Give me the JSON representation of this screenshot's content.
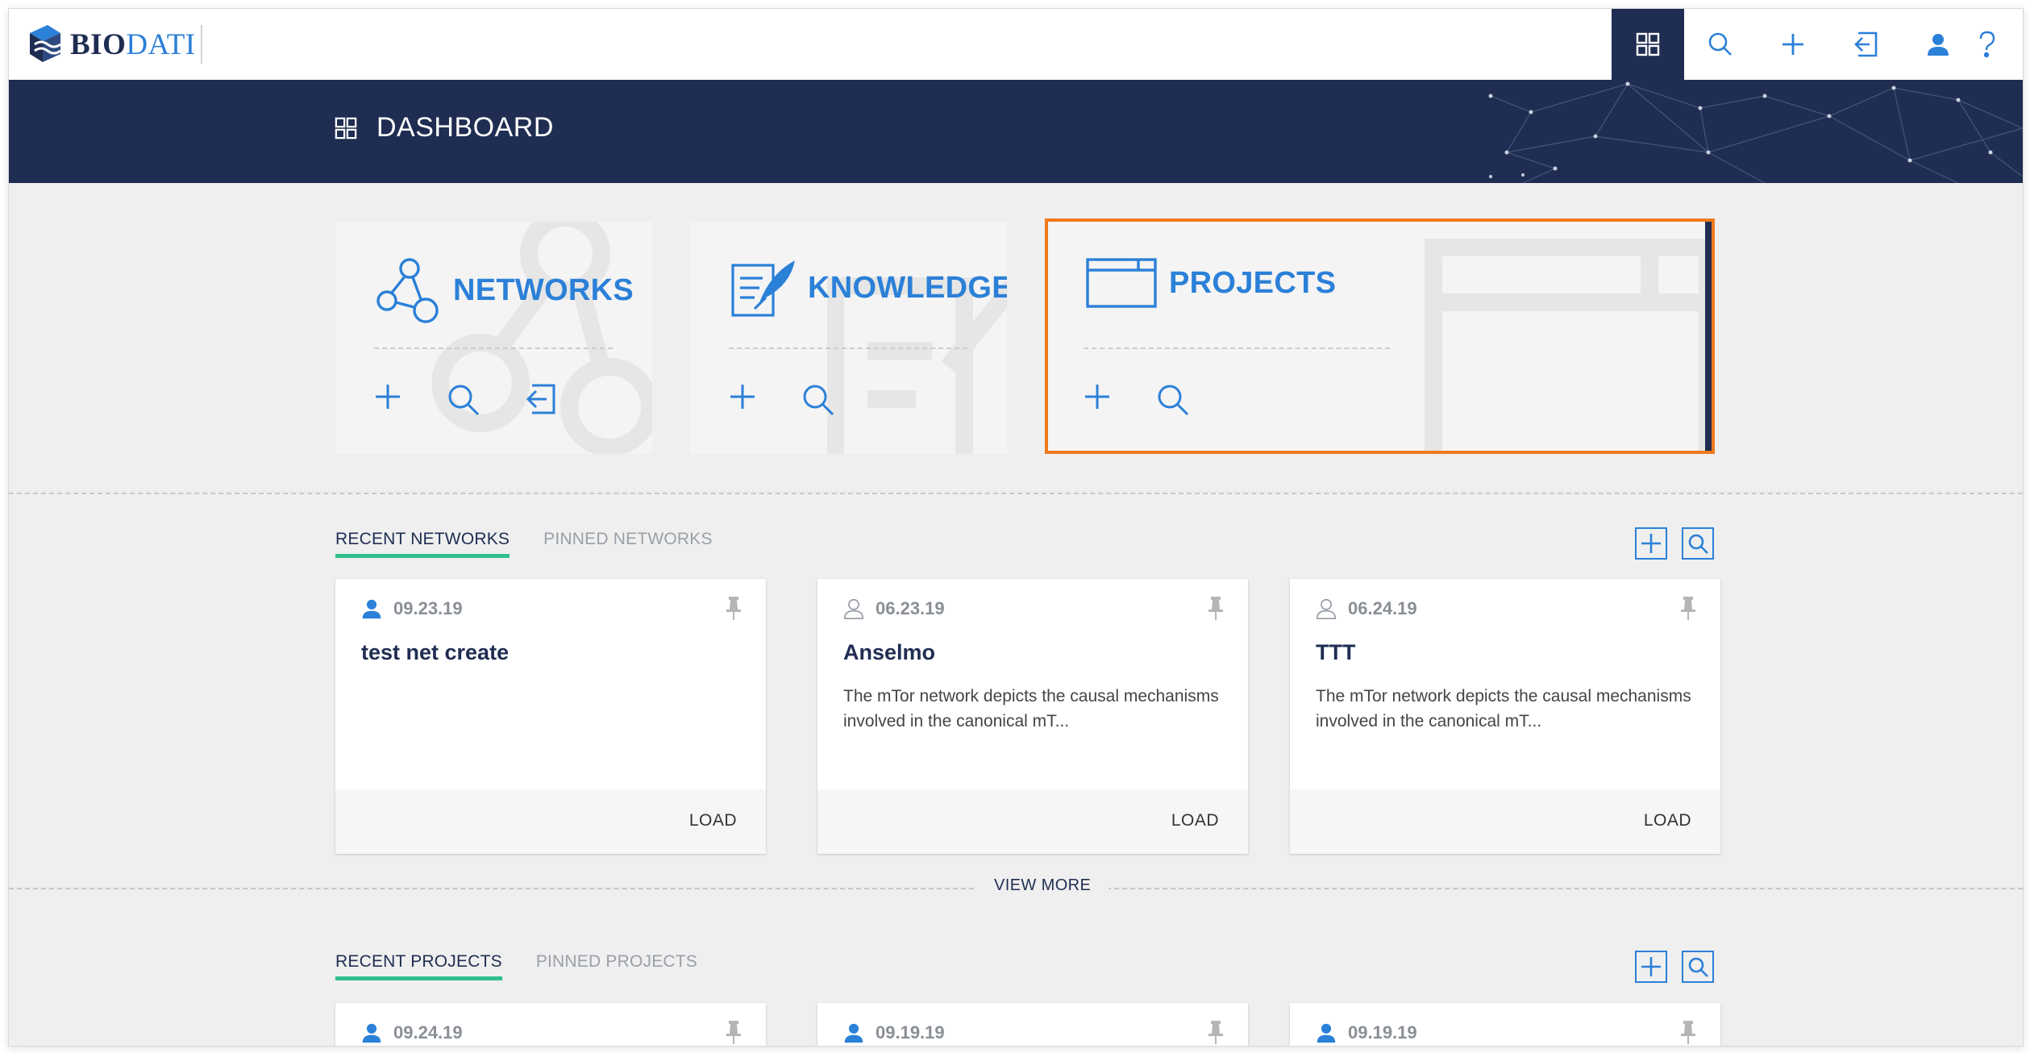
{
  "app": {
    "logo_bio": "BIO",
    "logo_dati": "DATI"
  },
  "nav": {
    "icons": [
      "dashboard-icon",
      "search-icon",
      "plus-icon",
      "import-icon",
      "user-icon",
      "help-icon"
    ]
  },
  "banner": {
    "title": "DASHBOARD"
  },
  "sections": {
    "networks": {
      "title": "NETWORKS"
    },
    "knowledge": {
      "title": "KNOWLEDGE"
    },
    "projects": {
      "title": "PROJECTS"
    }
  },
  "network_tabs": {
    "active": "RECENT NETWORKS",
    "inactive": "PINNED NETWORKS"
  },
  "networks": [
    {
      "date": "09.23.19",
      "title": "test net create",
      "description": "",
      "action": "LOAD",
      "owner_icon": "user-filled-icon"
    },
    {
      "date": "06.23.19",
      "title": "Anselmo",
      "description": "The mTor network depicts the causal mechanisms involved in the canonical mT...",
      "action": "LOAD",
      "owner_icon": "user-outline-icon"
    },
    {
      "date": "06.24.19",
      "title": "TTT",
      "description": "The mTor network depicts the causal mechanisms involved in the canonical mT...",
      "action": "LOAD",
      "owner_icon": "user-outline-icon"
    }
  ],
  "view_more": "VIEW MORE",
  "project_tabs": {
    "active": "RECENT PROJECTS",
    "inactive": "PINNED PROJECTS"
  },
  "projects": [
    {
      "date": "09.24.19"
    },
    {
      "date": "09.19.19"
    },
    {
      "date": "09.19.19"
    }
  ],
  "colors": {
    "navy": "#1f2d52",
    "accent": "#2b80d8",
    "highlight": "#f07a1c",
    "tab_underline": "#2fbf8a"
  }
}
